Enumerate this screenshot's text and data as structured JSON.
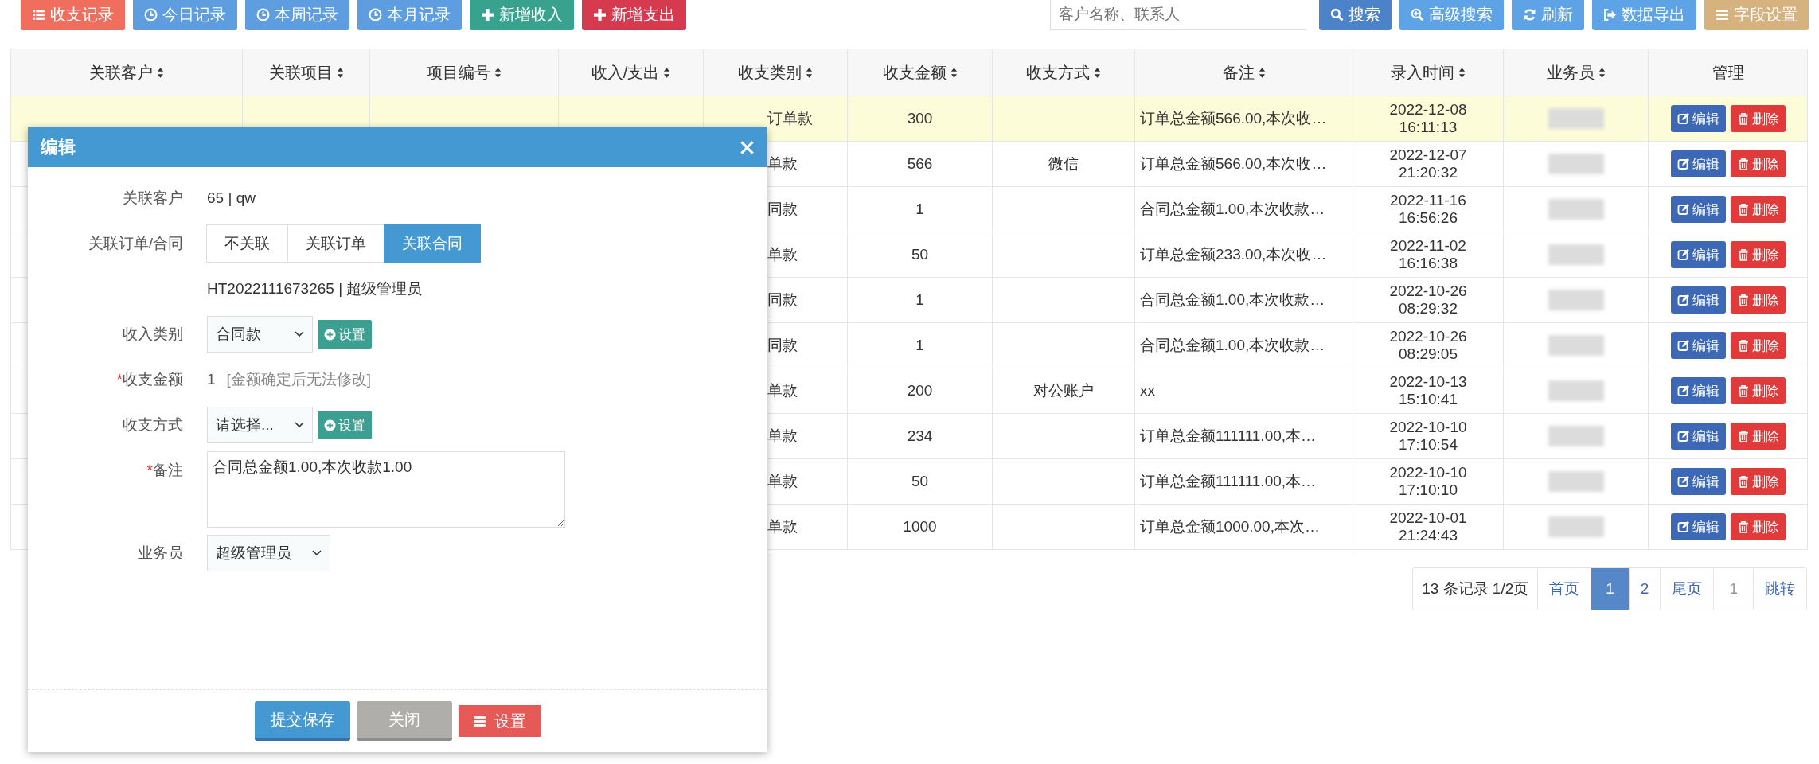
{
  "toolbar": {
    "left_buttons": [
      {
        "label": "收支记录",
        "kind": "records"
      },
      {
        "label": "今日记录",
        "kind": "period"
      },
      {
        "label": "本周记录",
        "kind": "period"
      },
      {
        "label": "本月记录",
        "kind": "period"
      },
      {
        "label": "新增收入",
        "kind": "income"
      },
      {
        "label": "新增支出",
        "kind": "expense"
      }
    ],
    "search": {
      "placeholder": "客户名称、联系人"
    },
    "right_buttons": [
      {
        "label": "搜索",
        "kind": "search"
      },
      {
        "label": "高级搜索",
        "kind": "advanced"
      },
      {
        "label": "刷新",
        "kind": "refresh"
      },
      {
        "label": "数据导出",
        "kind": "export"
      },
      {
        "label": "字段设置",
        "kind": "fields"
      }
    ]
  },
  "table": {
    "columns": [
      {
        "label": "关联客户",
        "sortable": true
      },
      {
        "label": "关联项目",
        "sortable": true
      },
      {
        "label": "项目编号",
        "sortable": true
      },
      {
        "label": "收入/支出",
        "sortable": true
      },
      {
        "label": "收支类别",
        "sortable": true
      },
      {
        "label": "收支金额",
        "sortable": true
      },
      {
        "label": "收支方式",
        "sortable": true
      },
      {
        "label": "备注",
        "sortable": true
      },
      {
        "label": "录入时间",
        "sortable": true
      },
      {
        "label": "业务员",
        "sortable": true
      },
      {
        "label": "管理",
        "sortable": false
      }
    ],
    "rows": [
      {
        "selected": true,
        "category": "订单款",
        "amount": "300",
        "method": "",
        "note": "订单总金额566.00,本次收…",
        "time": "2022-12-08 16:11:13",
        "actions": [
          "编辑",
          "删除"
        ]
      },
      {
        "selected": false,
        "category": "单款",
        "amount": "566",
        "method": "微信",
        "note": "订单总金额566.00,本次收…",
        "time": "2022-12-07 21:20:32",
        "actions": [
          "编辑",
          "删除"
        ]
      },
      {
        "selected": false,
        "category": "同款",
        "amount": "1",
        "method": "",
        "note": "合同总金额1.00,本次收款…",
        "time": "2022-11-16 16:56:26",
        "actions": [
          "编辑",
          "删除"
        ]
      },
      {
        "selected": false,
        "category": "单款",
        "amount": "50",
        "method": "",
        "note": "订单总金额233.00,本次收…",
        "time": "2022-11-02 16:16:38",
        "actions": [
          "编辑",
          "删除"
        ]
      },
      {
        "selected": false,
        "category": "同款",
        "amount": "1",
        "method": "",
        "note": "合同总金额1.00,本次收款…",
        "time": "2022-10-26 08:29:32",
        "actions": [
          "编辑",
          "删除"
        ]
      },
      {
        "selected": false,
        "category": "同款",
        "amount": "1",
        "method": "",
        "note": "合同总金额1.00,本次收款…",
        "time": "2022-10-26 08:29:05",
        "actions": [
          "编辑",
          "删除"
        ]
      },
      {
        "selected": false,
        "category": "单款",
        "amount": "200",
        "method": "对公账户",
        "note": "xx",
        "time": "2022-10-13 15:10:41",
        "actions": [
          "编辑",
          "删除"
        ]
      },
      {
        "selected": false,
        "category": "单款",
        "amount": "234",
        "method": "",
        "note": "订单总金额111111.00,本…",
        "time": "2022-10-10 17:10:54",
        "actions": [
          "编辑",
          "删除"
        ]
      },
      {
        "selected": false,
        "category": "单款",
        "amount": "50",
        "method": "",
        "note": "订单总金额111111.00,本…",
        "time": "2022-10-10 17:10:10",
        "actions": [
          "编辑",
          "删除"
        ]
      },
      {
        "selected": false,
        "category": "单款",
        "amount": "1000",
        "method": "",
        "note": "订单总金额1000.00,本次…",
        "time": "2022-10-01 21:24:43",
        "actions": [
          "编辑",
          "删除"
        ]
      }
    ]
  },
  "pagination": {
    "summary": "13 条记录 1/2页",
    "items": [
      {
        "label": "首页",
        "kind": "link"
      },
      {
        "label": "1",
        "kind": "page",
        "selected": true
      },
      {
        "label": "2",
        "kind": "page",
        "selected": false
      },
      {
        "label": "尾页",
        "kind": "link"
      },
      {
        "label": "1",
        "kind": "input"
      },
      {
        "label": "跳转",
        "kind": "link"
      }
    ]
  },
  "dialog": {
    "title": "编辑",
    "fields": [
      {
        "kind": "text",
        "label": "关联客户",
        "value": "65 | qw"
      },
      {
        "kind": "segmented",
        "label": "关联订单/合同",
        "options": [
          {
            "label": "不关联",
            "selected": false
          },
          {
            "label": "关联订单",
            "selected": false
          },
          {
            "label": "关联合同",
            "selected": true
          }
        ]
      },
      {
        "kind": "text",
        "value": "HT2022111673265 | 超级管理员"
      },
      {
        "kind": "select",
        "label": "收入类别",
        "value": "合同款",
        "button": "设置"
      },
      {
        "kind": "amount",
        "label": "收支金额",
        "mark": "*",
        "value": "1",
        "hint": "[金额确定后无法修改]"
      },
      {
        "kind": "select",
        "label": "收支方式",
        "value": "请选择...",
        "button": "设置"
      },
      {
        "kind": "textarea",
        "label": "备注",
        "mark": "*",
        "value": "合同总金额1.00,本次收款1.00"
      },
      {
        "kind": "select",
        "label": "业务员",
        "value": "超级管理员"
      }
    ],
    "buttons": [
      {
        "label": "提交保存",
        "kind": "primary"
      },
      {
        "label": "关闭",
        "kind": "close"
      },
      {
        "label": "设置",
        "kind": "settings"
      }
    ]
  }
}
